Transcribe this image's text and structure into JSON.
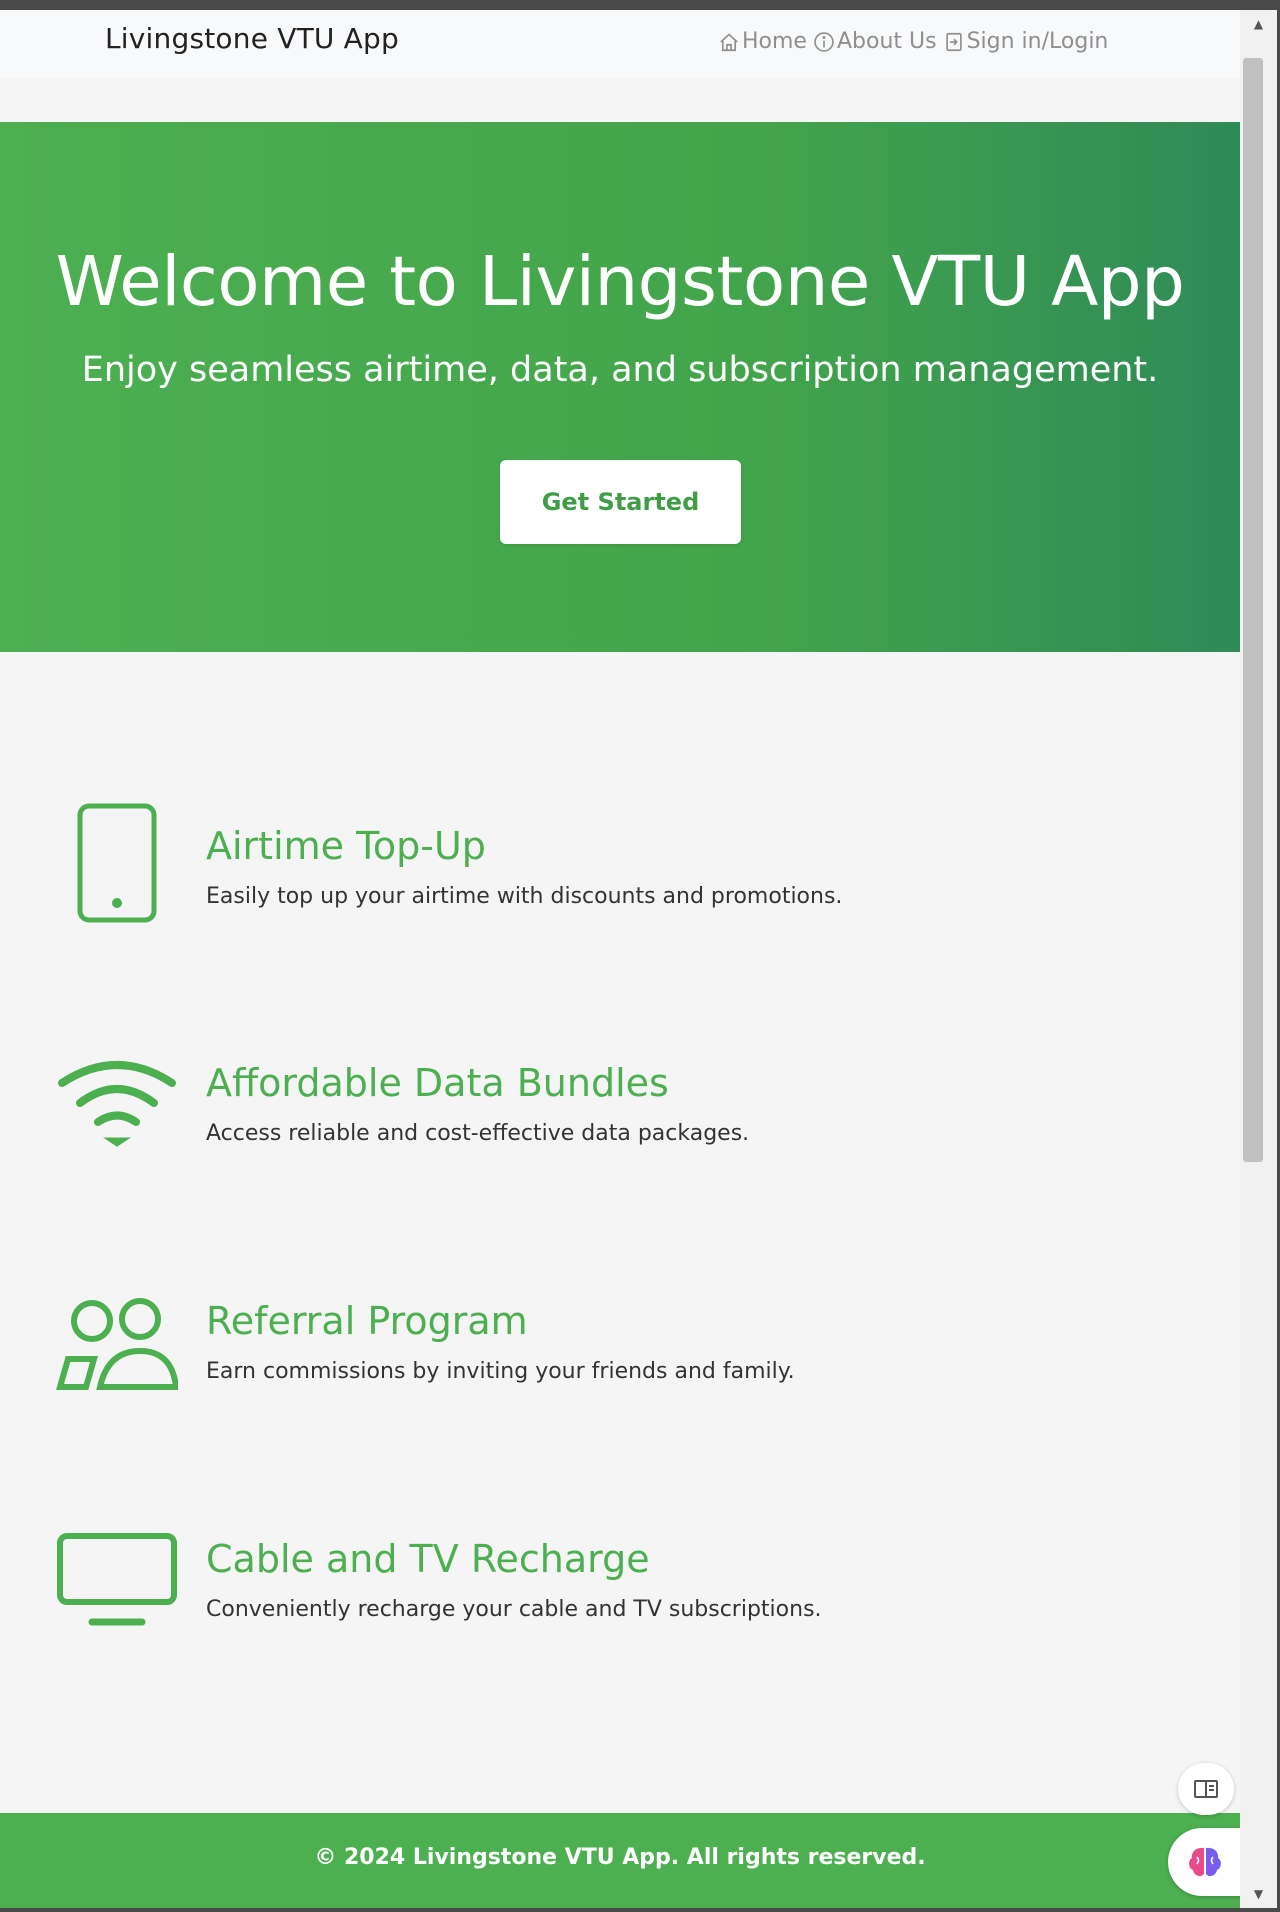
{
  "navbar": {
    "brand": "Livingstone VTU App",
    "links": [
      {
        "label": "Home",
        "icon": "home-icon"
      },
      {
        "label": "About Us",
        "icon": "info-icon"
      },
      {
        "label": "Sign in/Login",
        "icon": "login-icon"
      }
    ]
  },
  "hero": {
    "title": "Welcome to Livingstone VTU App",
    "subtitle": "Enjoy seamless airtime, data, and subscription management.",
    "cta_label": "Get Started"
  },
  "features": [
    {
      "title": "Airtime Top-Up",
      "description": "Easily top up your airtime with discounts and promotions.",
      "icon": "phone-icon"
    },
    {
      "title": "Affordable Data Bundles",
      "description": "Access reliable and cost-effective data packages.",
      "icon": "wifi-icon"
    },
    {
      "title": "Referral Program",
      "description": "Earn commissions by inviting your friends and family.",
      "icon": "people-icon"
    },
    {
      "title": "Cable and TV Recharge",
      "description": "Conveniently recharge your cable and TV subscriptions.",
      "icon": "tv-icon"
    }
  ],
  "footer": {
    "text": "© 2024 Livingstone VTU App. All rights reserved."
  },
  "colors": {
    "primary": "#4caf50",
    "primary_dark": "#2e8b57",
    "background": "#f5f5f5",
    "navbar_bg": "#f8f9fa"
  }
}
